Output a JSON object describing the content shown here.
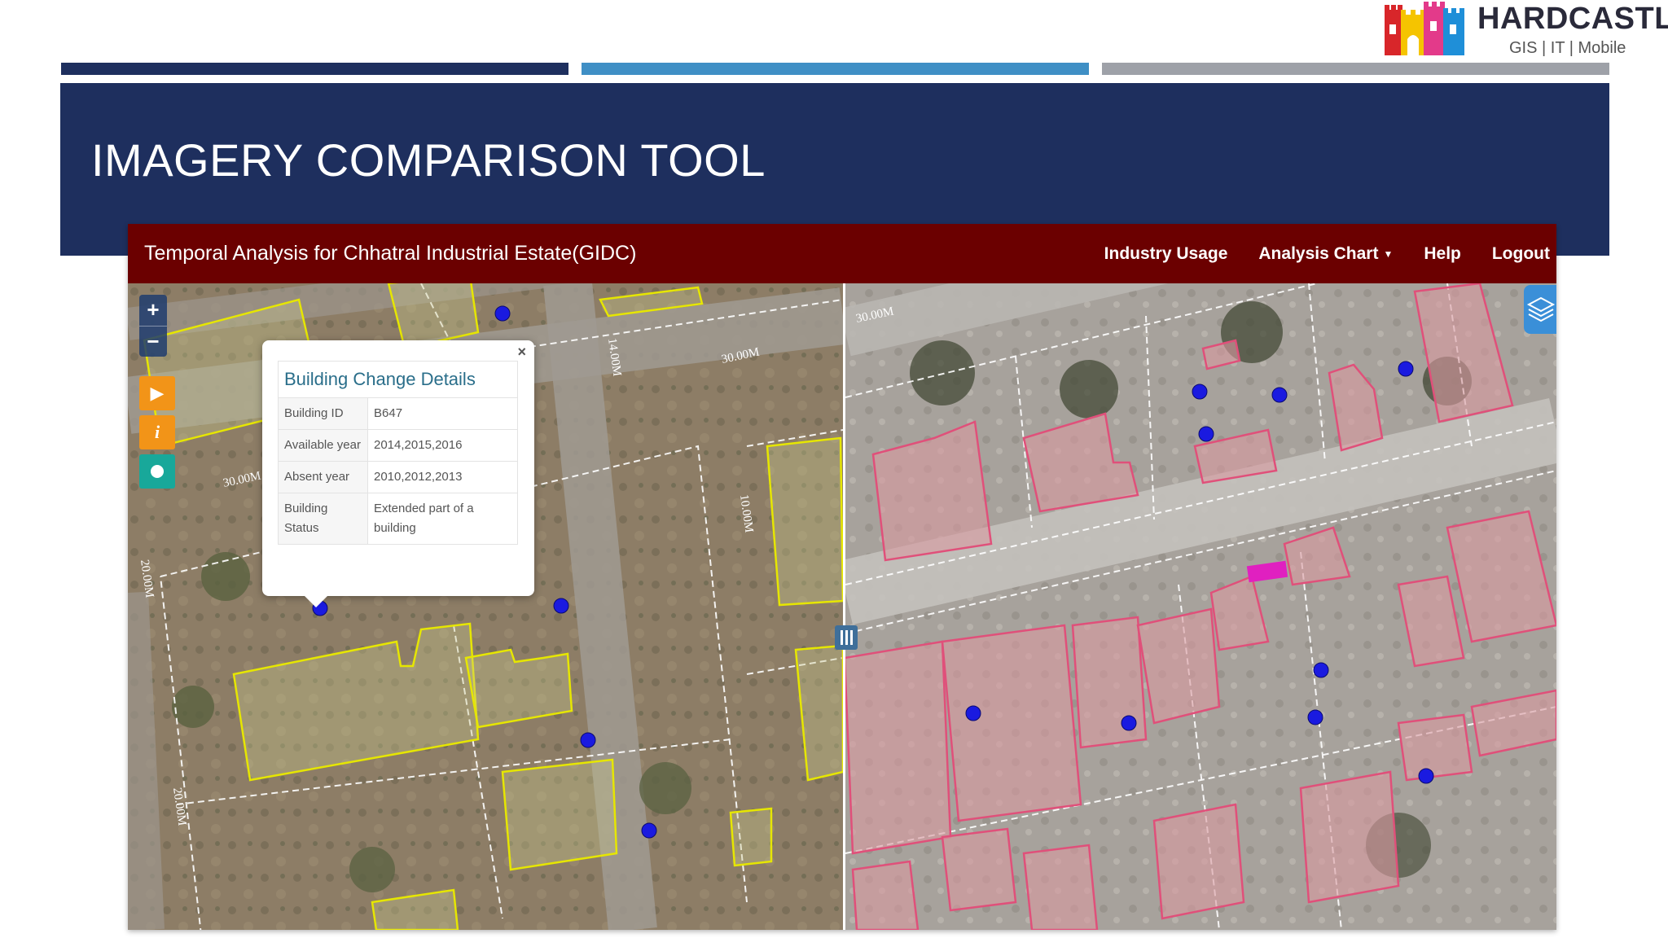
{
  "logo": {
    "name": "HARDCASTLE",
    "tagline": "GIS | IT | Mobile"
  },
  "slide": {
    "title": "IMAGERY COMPARISON TOOL"
  },
  "colors": {
    "title_band": "#1e2f5e",
    "stripe_1": "#1e2f5e",
    "stripe_2": "#3f8fc5",
    "stripe_3": "#9ea1a8",
    "nav": "#6b0000",
    "parcel_left": "#e6e600",
    "parcel_right": "#e0507a",
    "marker": "#1a1ae0",
    "highlight": "#e020c0"
  },
  "app": {
    "title": "Temporal Analysis for Chhatral Industrial Estate(GIDC)",
    "nav": {
      "industry_usage": "Industry Usage",
      "analysis_chart": "Analysis Chart",
      "help": "Help",
      "logout": "Logout"
    }
  },
  "map": {
    "controls": {
      "zoom_in": "+",
      "zoom_out": "−",
      "play_icon": "play-icon",
      "info_icon": "info-icon",
      "circle_icon": "circle-icon",
      "layers_icon": "layers-icon"
    },
    "labels_left": [
      "30.00M",
      "14.00M",
      "30.00M",
      "10.00M",
      "20.00M",
      "20.00M"
    ],
    "labels_right": [
      "30.00M"
    ]
  },
  "popup": {
    "title": "Building Change Details",
    "close": "×",
    "rows": [
      {
        "key": "Building ID",
        "value": "B647"
      },
      {
        "key": "Available year",
        "value": "2014,2015,2016"
      },
      {
        "key": "Absent year",
        "value": "2010,2012,2013"
      },
      {
        "key": "Building Status",
        "value": "Extended part of a building"
      }
    ]
  }
}
